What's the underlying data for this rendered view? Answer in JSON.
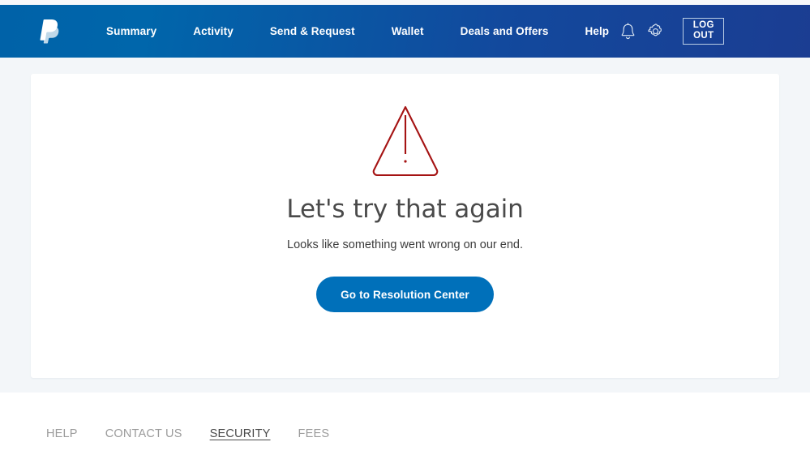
{
  "brand": {
    "logo_icon": "paypal-logo-icon",
    "header_gradient_start": "#0070ba",
    "header_gradient_end": "#1b3d92",
    "accent_blue": "#0070ba"
  },
  "header": {
    "nav_items": [
      {
        "label": "Summary"
      },
      {
        "label": "Activity"
      },
      {
        "label": "Send & Request"
      },
      {
        "label": "Wallet"
      },
      {
        "label": "Deals and Offers"
      },
      {
        "label": "Help"
      }
    ],
    "notifications_icon": "bell-icon",
    "settings_icon": "gear-icon",
    "logout_label": "LOG OUT"
  },
  "main": {
    "error_icon": "warning-triangle-icon",
    "error_icon_color": "#a01010",
    "title": "Let's try that again",
    "subtitle": "Looks like something went wrong on our end.",
    "cta_label": "Go to Resolution Center"
  },
  "footer": {
    "links": [
      {
        "label": "HELP",
        "active": false
      },
      {
        "label": "CONTACT US",
        "active": false
      },
      {
        "label": "SECURITY",
        "active": true
      },
      {
        "label": "FEES",
        "active": false
      }
    ]
  }
}
